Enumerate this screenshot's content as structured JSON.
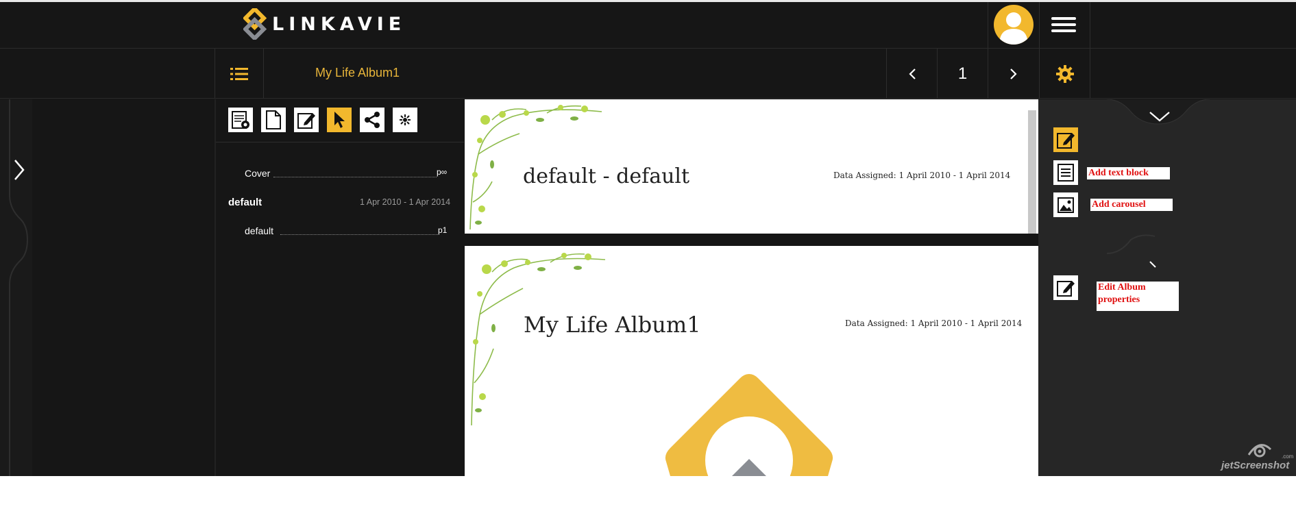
{
  "brand": {
    "name": "LINKAVIE"
  },
  "header": {
    "album_title": "My Life Album1",
    "page_number": "1"
  },
  "toolbar": {
    "tools": [
      {
        "icon": "album-settings-icon"
      },
      {
        "icon": "page-icon"
      },
      {
        "icon": "edit-icon"
      },
      {
        "icon": "pointer-icon",
        "active": true
      },
      {
        "icon": "share-icon"
      },
      {
        "icon": "plugin-icon"
      }
    ]
  },
  "toc": {
    "items": [
      {
        "label": "Cover",
        "page": "p∞"
      },
      {
        "label": "default",
        "dates": "1 Apr 2010 - 1 Apr 2014"
      },
      {
        "label": "default",
        "page": "p1"
      }
    ]
  },
  "pages": [
    {
      "title": "default - default",
      "dates": "Data Assigned: 1 April 2010 - 1 April 2014"
    },
    {
      "title": "My Life Album1",
      "dates": "Data Assigned: 1 April 2010 - 1 April 2014"
    }
  ],
  "side_actions": {
    "add_text_block": "Add text block",
    "add_carousel": "Add carousel",
    "edit_album_properties": "Edit Album properties"
  },
  "watermark": {
    "text": "jetScreenshot",
    "suffix": ".com"
  },
  "colors": {
    "accent": "#f2b82d",
    "background": "#161616",
    "tip_text": "#e01010"
  }
}
